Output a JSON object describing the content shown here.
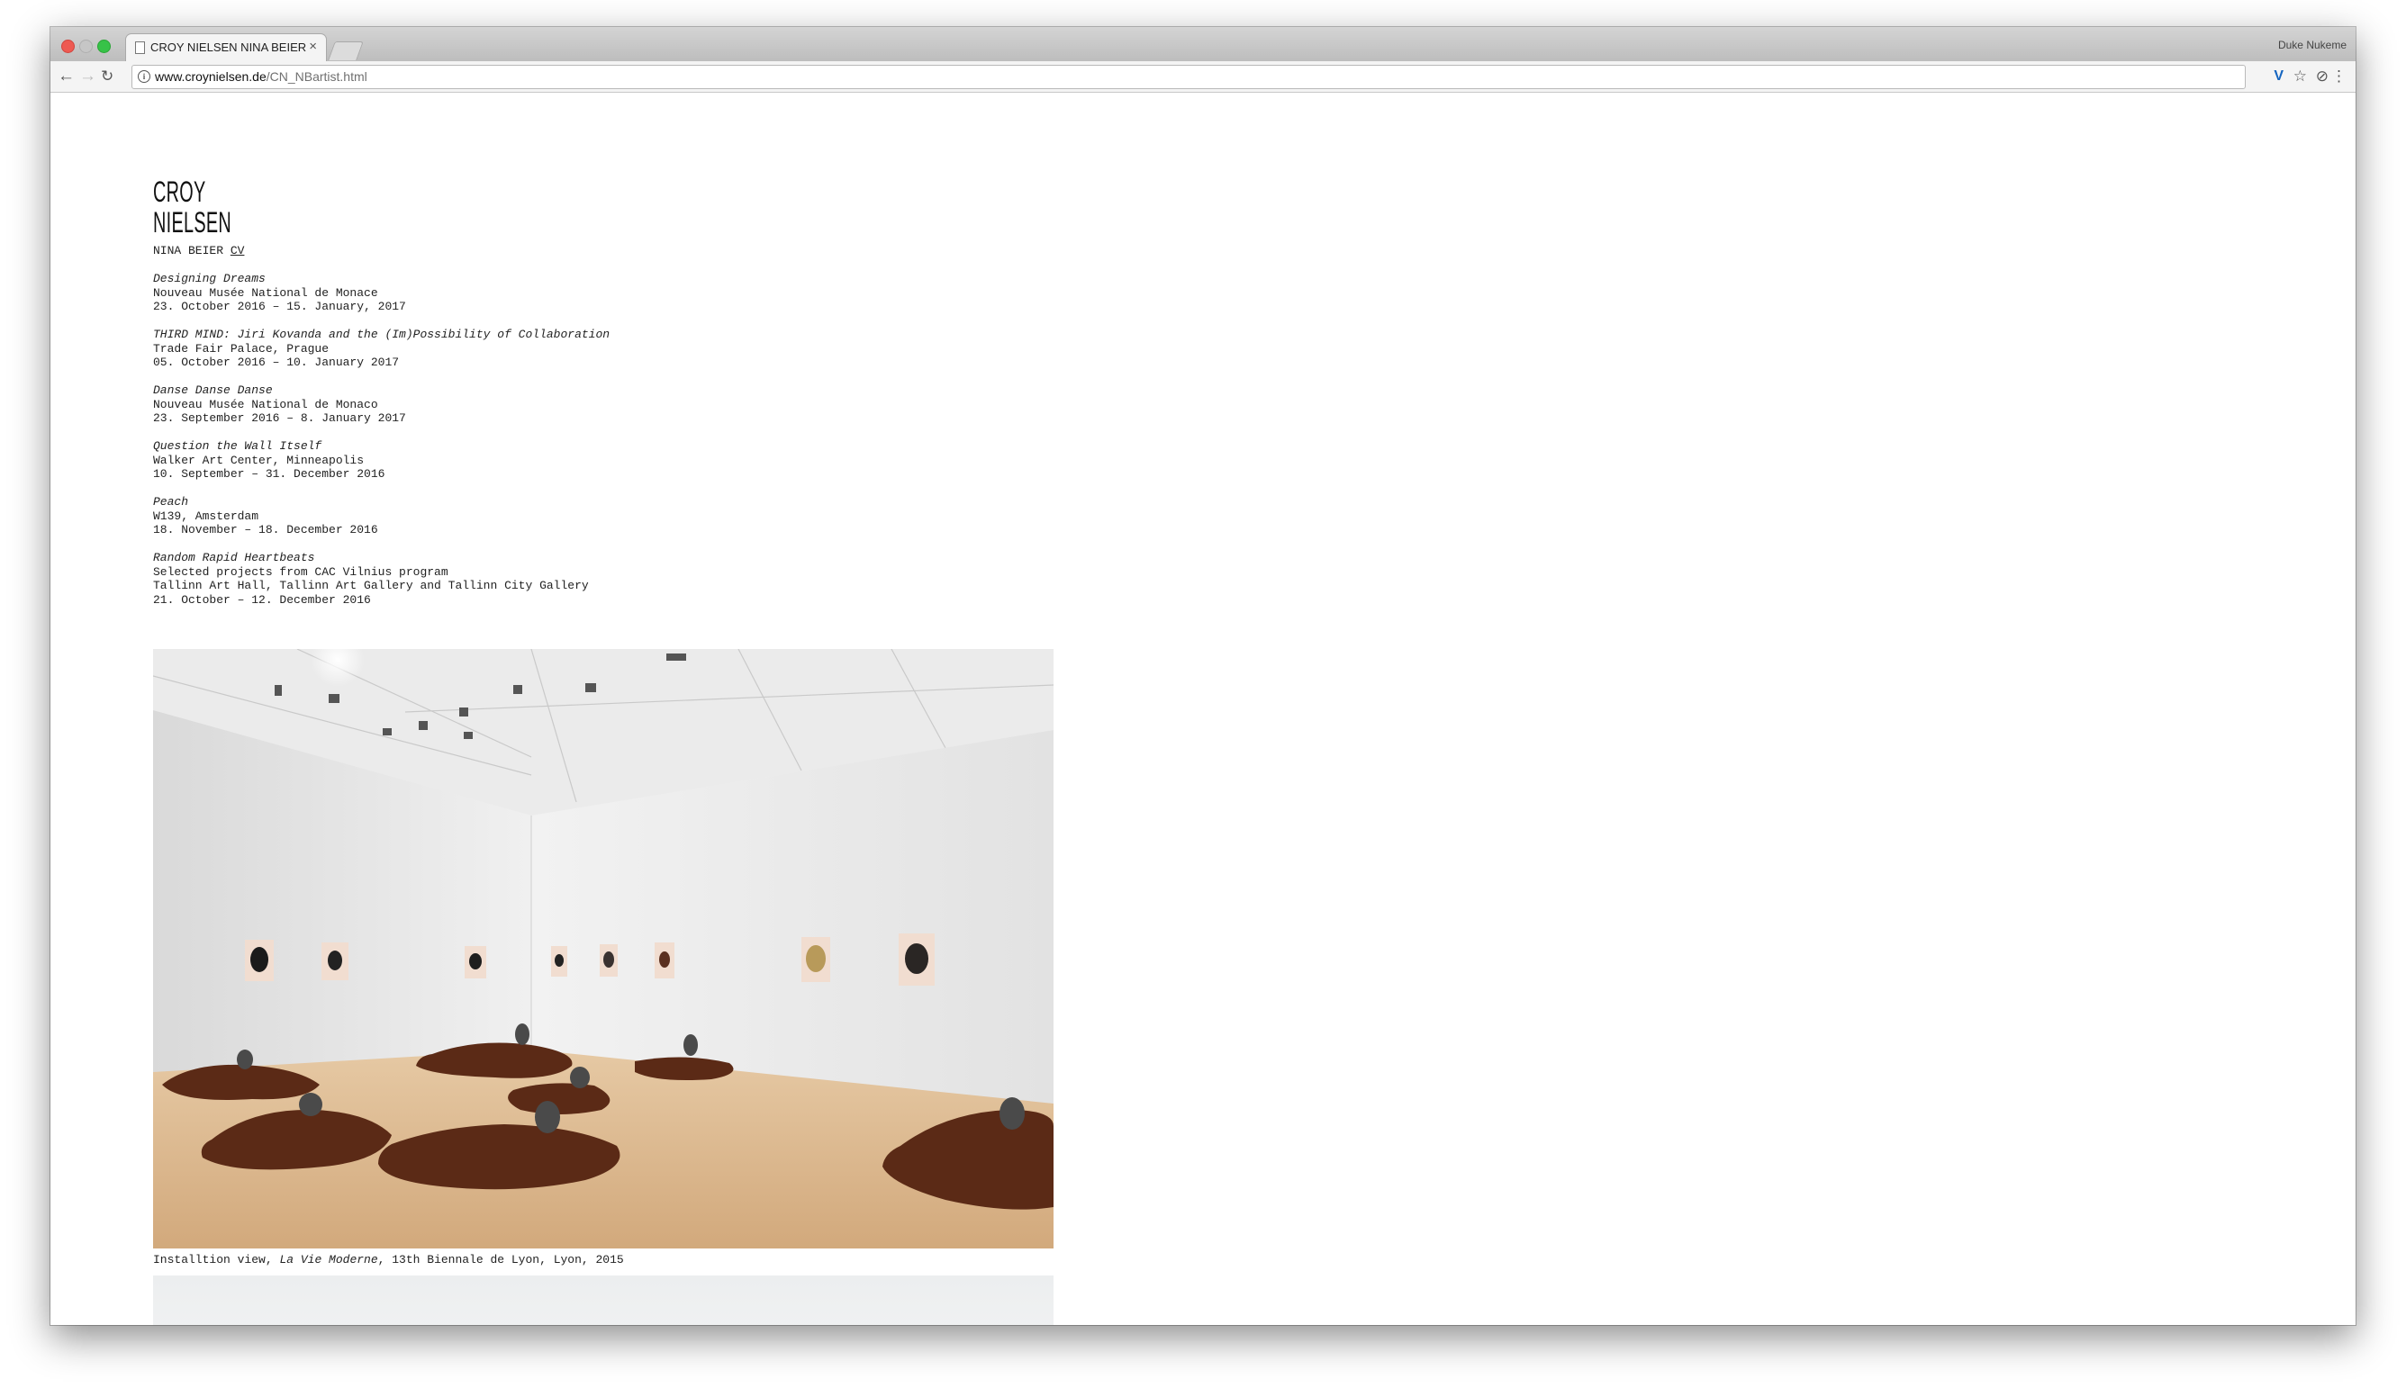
{
  "browser": {
    "tab_title": "CROY NIELSEN NINA BEIER",
    "tab_close": "×",
    "profile_name": "Duke Nukeme",
    "url_host": "www.croynielsen.de",
    "url_path": "/CN_NBartist.html"
  },
  "site": {
    "logo_line1": "CROY",
    "logo_line2": "NIELSEN",
    "artist_name": "NINA BEIER",
    "cv_link": "CV"
  },
  "exhibitions": [
    {
      "title": "Designing Dreams",
      "lines": [
        "Nouveau Musée National de Monace",
        "23. October 2016 – 15. January, 2017"
      ]
    },
    {
      "title": "THIRD MIND: Jiri Kovanda and the (Im)Possibility of Collaboration",
      "lines": [
        "Trade Fair Palace, Prague",
        "05. October 2016 – 10. January 2017"
      ]
    },
    {
      "title": "Danse Danse Danse",
      "lines": [
        "Nouveau Musée National de Monaco",
        "23. September 2016 – 8. January 2017"
      ]
    },
    {
      "title": "Question the Wall Itself",
      "lines": [
        "Walker Art Center, Minneapolis",
        "10. September – 31. December 2016"
      ]
    },
    {
      "title": "Peach",
      "lines": [
        "W139, Amsterdam",
        "18. November – 18. December 2016"
      ]
    },
    {
      "title": "Random Rapid Heartbeats",
      "lines": [
        "Selected projects from CAC Vilnius program",
        "Tallinn Art Hall, Tallinn Art Gallery and Tallinn City Gallery",
        "21. October – 12. December 2016"
      ]
    }
  ],
  "caption": {
    "prefix": "Installtion view, ",
    "title": "La Vie Moderne",
    "suffix": ", 13th Biennale de Lyon, Lyon, 2015"
  }
}
